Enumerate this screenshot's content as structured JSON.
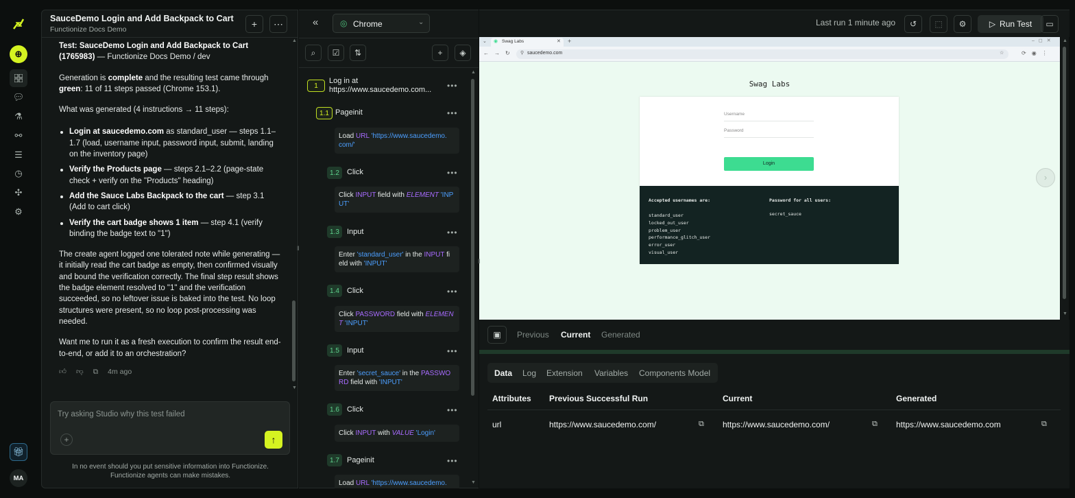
{
  "rail": {
    "logo": "functionize-logo",
    "avatar_initials": "MA"
  },
  "chat": {
    "title": "SauceDemo Login and Add Backpack to Cart",
    "subtitle": "Functionize Docs Demo",
    "message": {
      "test_title": "Test: SauceDemo Login and Add Backpack to Cart (1765983)",
      "test_context": " — Functionize Docs Demo / dev",
      "p1_a": "Generation is ",
      "p1_b": "complete",
      "p1_c": " and the resulting test came through ",
      "p1_d": "green",
      "p1_e": ": 11 of 11 steps passed (Chrome 153.1).",
      "p2": "What was generated (4 instructions → 11 steps):",
      "bullets": [
        {
          "bold": "Login at saucedemo.com",
          "text": " as standard_user — steps 1.1–1.7 (load, username input, password input, submit, landing on the inventory page)"
        },
        {
          "bold": "Verify the Products page",
          "text": " — steps 2.1–2.2 (page-state check + verify on the \"Products\" heading)"
        },
        {
          "bold": "Add the Sauce Labs Backpack to the cart",
          "text": " — step 3.1 (Add to cart click)"
        },
        {
          "bold": "Verify the cart badge shows 1 item",
          "text": " — step 4.1 (verify binding the badge text to \"1\")"
        }
      ],
      "p3": "The create agent logged one tolerated note while generating — it initially read the cart badge as empty, then confirmed visually and bound the verification correctly. The final step result shows the badge element resolved to \"1\" and the verification succeeded, so no leftover issue is baked into the test. No loop structures were present, so no loop post-processing was needed.",
      "p4": "Want me to run it as a fresh execution to confirm the result end-to-end, or add it to an orchestration?",
      "time": "4m ago"
    },
    "input_placeholder": "Try asking Studio why this test failed",
    "disclaimer_1": "In no event should you put sensitive information into Functionize.",
    "disclaimer_2": "Functionize agents can make mistakes."
  },
  "steps": {
    "step1": {
      "num": "1",
      "label_1": "Log in at",
      "label_2": "https://www.saucedemo.com..."
    },
    "sub": [
      {
        "num": "1.1",
        "label": "Pageinit"
      },
      {
        "num": "1.2",
        "label": "Click"
      },
      {
        "num": "1.3",
        "label": "Input"
      },
      {
        "num": "1.4",
        "label": "Click"
      },
      {
        "num": "1.5",
        "label": "Input"
      },
      {
        "num": "1.6",
        "label": "Click"
      },
      {
        "num": "1.7",
        "label": "Pageinit"
      }
    ],
    "cards": {
      "c1": {
        "a": "Load ",
        "b": "URL",
        "c": " 'https://www.saucedemo.",
        "d": "com/'"
      },
      "c2": {
        "a": "Click ",
        "b": "INPUT",
        "c": "  field with ",
        "d": "ELEMENT",
        "e": " 'INP",
        "f": "UT'"
      },
      "c3": {
        "a": "Enter ",
        "b": "'standard_user'",
        "c": " in the ",
        "d": "INPUT",
        "e": "  fi",
        "f": "eld with ",
        "g": "'INPUT'"
      },
      "c4": {
        "a": "Click ",
        "b": "PASSWORD",
        "c": "  field with ",
        "d": "ELEMEN",
        "e": "T",
        "f": " 'INPUT'"
      },
      "c5": {
        "a": "Enter ",
        "b": "'secret_sauce'",
        "c": " in the ",
        "d": "PASSWO",
        "e": "RD",
        "f": "  field with ",
        "g": "'INPUT'"
      },
      "c6": {
        "a": "Click ",
        "b": "INPUT",
        "c": "  with ",
        "d": "VALUE",
        "e": " 'Login'"
      },
      "c7": {
        "a": "Load ",
        "b": "URL",
        "c": " 'https://www.saucedemo."
      }
    }
  },
  "topbar": {
    "browser": "Chrome",
    "last_run": "Last run 1 minute ago",
    "run_test": "Run Test"
  },
  "browser": {
    "tab_title": "Swag Labs",
    "address": "saucedemo.com",
    "site_title": "Swag Labs",
    "username_placeholder": "Username",
    "password_placeholder": "Password",
    "login_button": "Login",
    "accepted_title": "Accepted usernames are:",
    "usernames": [
      "standard_user",
      "locked_out_user",
      "problem_user",
      "performance_glitch_user",
      "error_user",
      "visual_user"
    ],
    "password_title": "Password for all users:",
    "password": "secret_sauce"
  },
  "bottom": {
    "view_tabs": [
      "Previous",
      "Current",
      "Generated"
    ],
    "active_view": "Current",
    "data_tabs": [
      "Data",
      "Log",
      "Extension",
      "Variables",
      "Components Model"
    ],
    "active_data_tab": "Data",
    "columns": [
      "Attributes",
      "Previous Successful Run",
      "Current",
      "Generated"
    ],
    "row": {
      "attr": "url",
      "previous": "https://www.saucedemo.com/",
      "current": "https://www.saucedemo.com/",
      "generated": "https://www.saucedemo.com"
    }
  },
  "colors": {
    "accent": "#d5f321",
    "step_green": "#5fd38d",
    "keyword": "#a86bff",
    "string": "#4c9fff",
    "login_button": "#3ddc91"
  }
}
